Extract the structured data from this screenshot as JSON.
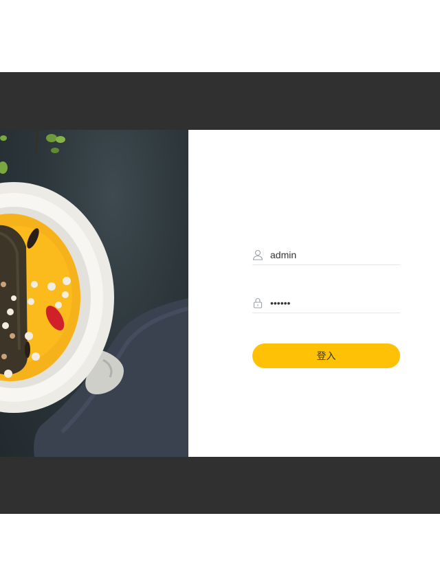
{
  "login": {
    "username_value": "admin",
    "password_value": "••••••",
    "submit_label": "登入"
  },
  "icons": {
    "user": "user-icon",
    "lock": "lock-icon"
  },
  "colors": {
    "frame": "#303030",
    "button": "#ffc106",
    "panel": "#ffffff"
  }
}
